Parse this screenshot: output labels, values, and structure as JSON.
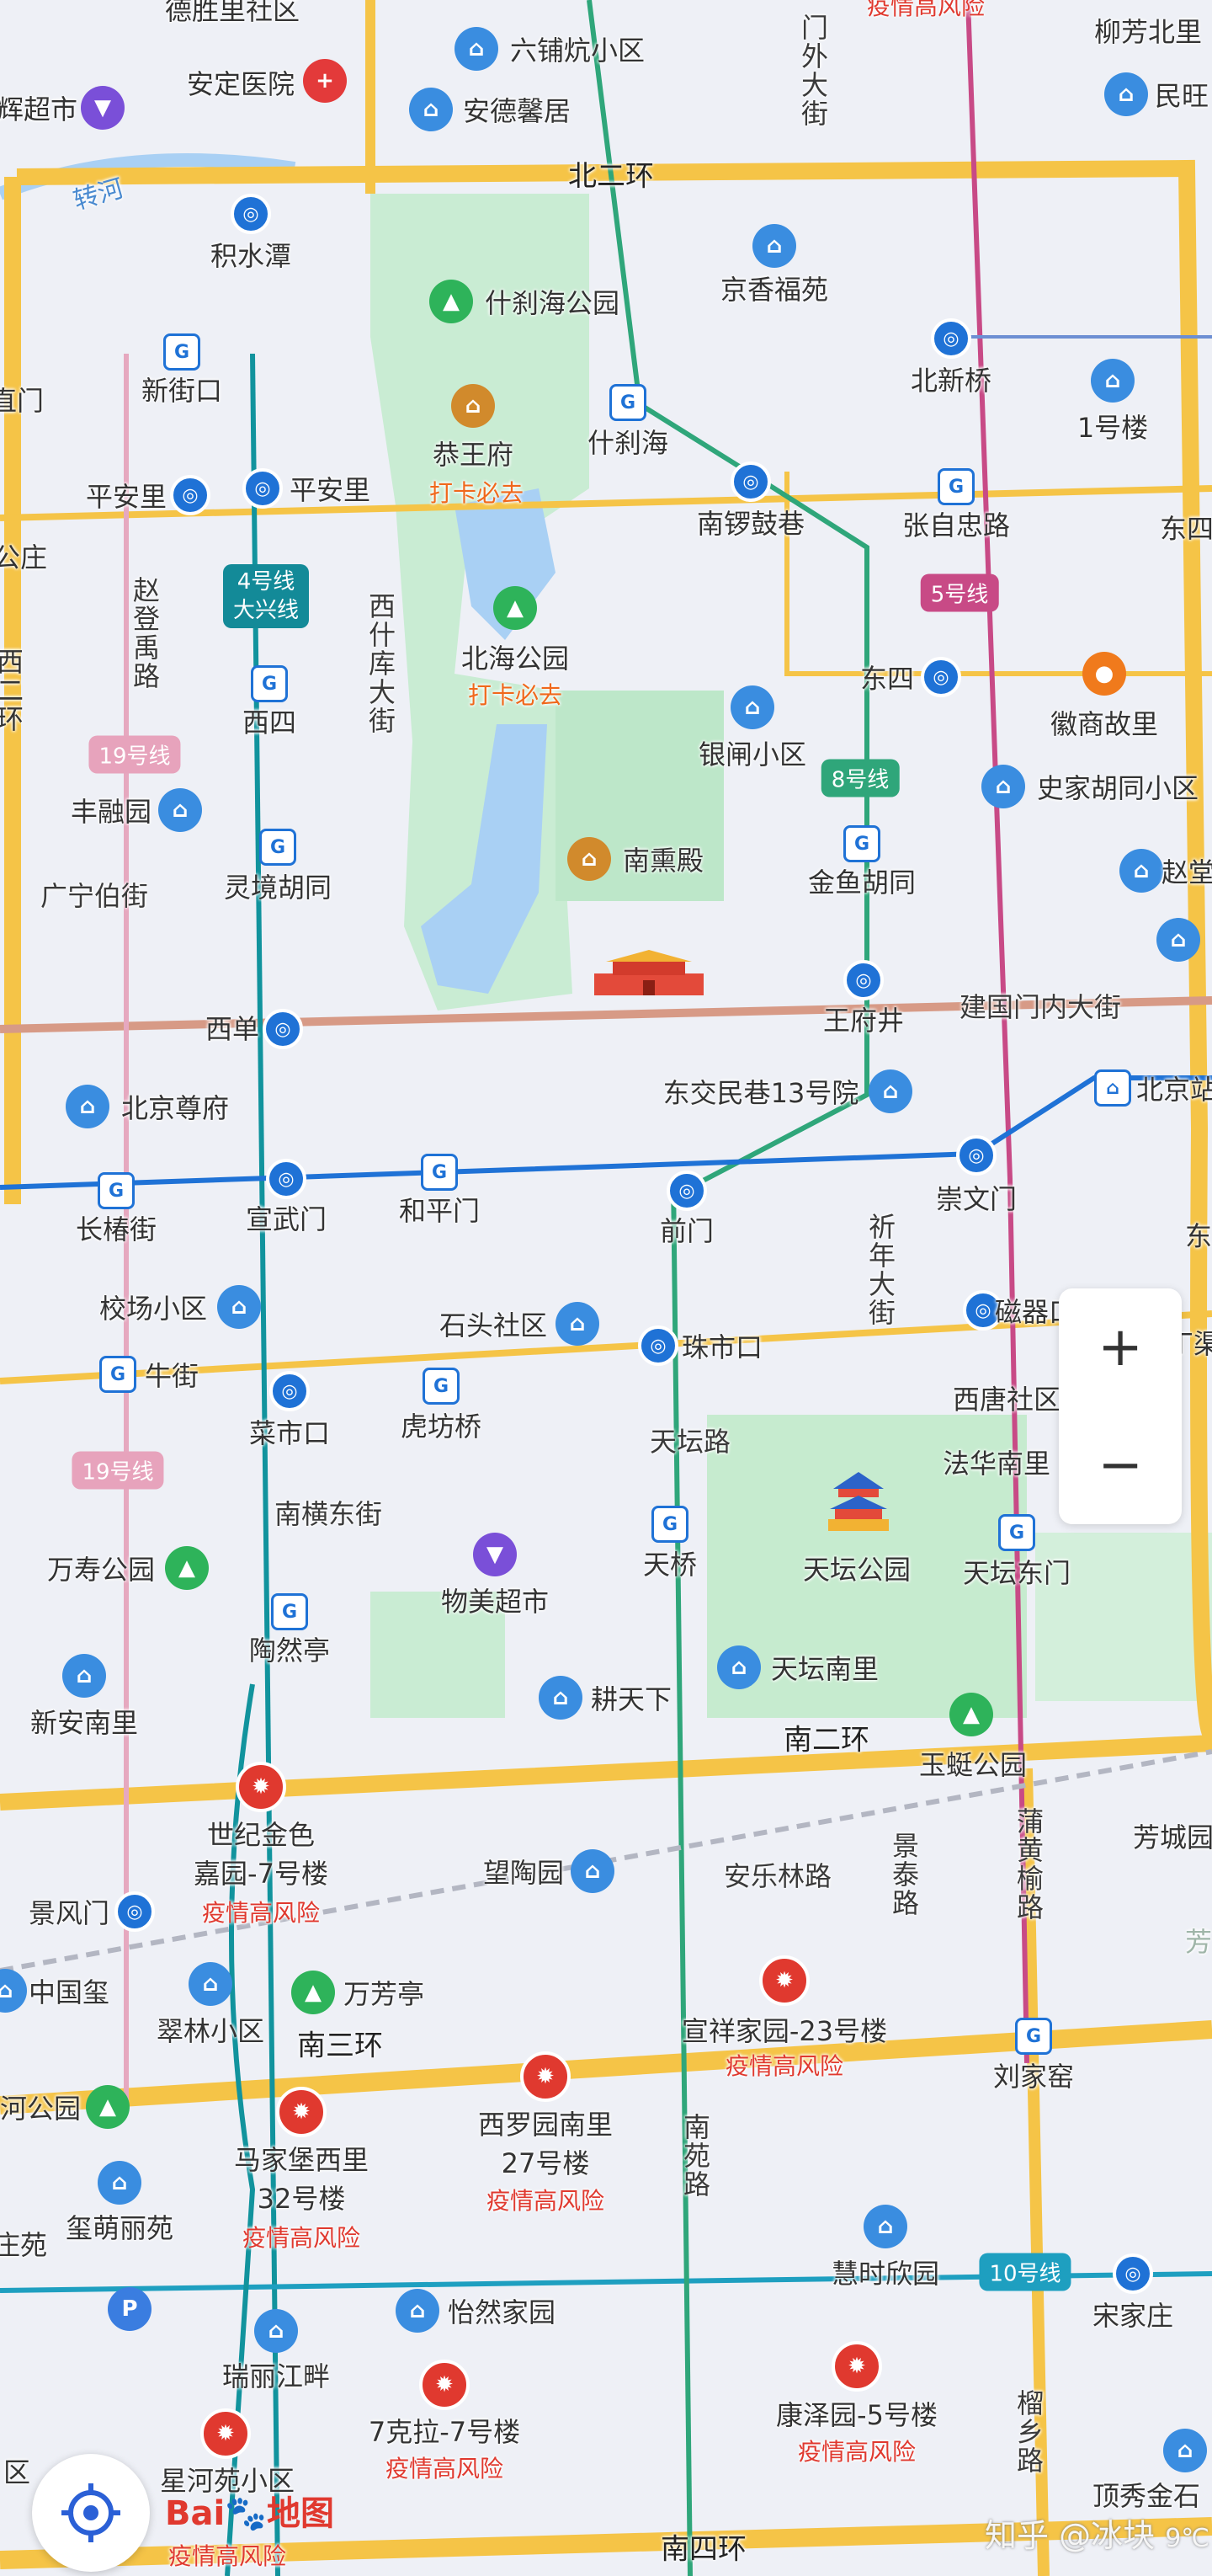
{
  "map": {
    "roads": {
      "ring2_north": "北二环",
      "ring2_south": "南二环",
      "ring3_south": "南三环",
      "ring4_south": "南四环",
      "jianguomen": "建国门内大街",
      "xishiku": "西什库大街",
      "zhaodengyu": "赵登禹路",
      "qinian": "祈年大街",
      "jingtai": "景泰路",
      "puhuangyu": "蒲黄榆路",
      "nanyuan": "南苑路",
      "liuxiang": "榴乡路",
      "tiantan_road": "天坛路",
      "nanheng_east": "南横东街",
      "guangning": "广宁伯街",
      "anle": "安乐林路",
      "outer_gate": "门外大街",
      "river": "转河"
    },
    "lines": {
      "line4": "4号线\n大兴线",
      "line5": "5号线",
      "line8": "8号线",
      "line10": "10号线",
      "line19a": "19号线",
      "line19b": "19号线"
    },
    "stations": {
      "jishuitan": "积水潭",
      "xinjiekou": "新街口",
      "pinganli": "平安里",
      "pinganli2": "平安里",
      "xisi": "西四",
      "lingjing": "灵境胡同",
      "xidan": "西单",
      "xuanwumen": "宣武门",
      "changchunjie": "长椿街",
      "hepingmen": "和平门",
      "qianmen": "前门",
      "chongwenmen": "崇文门",
      "shichahai": "什刹海",
      "nanluoguxiang": "南锣鼓巷",
      "zhangzizhong": "张自忠路",
      "beixinqiao": "北新桥",
      "dongsi": "东四",
      "jinyuhutong": "金鱼胡同",
      "wangfujing": "王府井",
      "zhushikou": "珠市口",
      "tianqiao": "天桥",
      "ciqikou": "磁器口",
      "tiantan_east": "天坛东门",
      "caishikou": "菜市口",
      "hufangqiao": "虎坊桥",
      "taoranting": "陶然亭",
      "niujie": "牛街",
      "jingfengmen": "景风门",
      "liujiayao": "刘家窑",
      "songjiazhuang": "宋家庄",
      "beijing_station": "北京站",
      "xizhimen": "直门",
      "xizhi2": "西二环"
    },
    "pois": {
      "desheng": "德胜里社区",
      "liupukang": "六铺炕小区",
      "liufang_north": "柳芳北里",
      "anding_hosp": "安定医院",
      "andingxin": "安德馨居",
      "minwang": "民旺",
      "hui_market": "辉超市",
      "shichahai_park": "什刹海公园",
      "jingxiang": "京香福苑",
      "gongwangfu": "恭王府",
      "checkin1": "打卡必去",
      "yihao": "1号楼",
      "beihai": "北海公园",
      "checkin2": "打卡必去",
      "yinzha": "银闸小区",
      "huishang": "徽商故里",
      "shijia": "史家胡同小区",
      "fengrong": "丰融园",
      "nanxun": "南熏殿",
      "zhaotang": "赵堂",
      "bj_zunfu": "北京尊府",
      "dongjiao": "东交民巷13号院",
      "xiaochang": "校场小区",
      "shitou": "石头社区",
      "xitang": "西唐社区",
      "fahua": "法华南里",
      "wanshou": "万寿公园",
      "wumei": "物美超市",
      "tiantan_park": "天坛公园",
      "xinan": "新安南里",
      "gengtianxia": "耕天下",
      "tiantan_south": "天坛南里",
      "yuting": "玉蜓公园",
      "shiji": "世纪金色\n嘉园-7号楼",
      "risk1": "疫情高风险",
      "wangtao": "望陶园",
      "fangcheng": "芳城园",
      "zhongguoxi": "中国玺",
      "cuilin": "翠林小区",
      "wanfangting": "万芳亭",
      "xuanxiang": "宣祥家园-23号楼",
      "risk2": "疫情高风险",
      "xiluo": "西罗园南里\n27号楼",
      "risk3": "疫情高风险",
      "majiabao": "马家堡西里\n32号楼",
      "risk4": "疫情高风险",
      "helu_park": "河公园",
      "ximeng": "玺萌丽苑",
      "huishixin": "慧时欣园",
      "yiran": "怡然家园",
      "ruili": "瑞丽江畔",
      "qikela": "7克拉-7号楼",
      "risk5": "疫情高风险",
      "kangze": "康泽园-5号楼",
      "risk6": "疫情高风险",
      "xinghe": "星河苑小区",
      "risk7": "疫情高风险",
      "dingxiu": "顶秀金石",
      "risk_top": "疫情高风险",
      "dong_kou": "东",
      "dong4": "东四",
      "dongcheng": "东",
      "fang": "芳",
      "qu": "区",
      "zhuang": "庄苑",
      "jizhai": "公庄",
      "qiaoka": "丁渠"
    },
    "controls": {
      "zoom_in": "+",
      "zoom_out": "−",
      "logo_bai": "Bai",
      "logo_du": "du",
      "logo_map": "地图",
      "watermark": "知乎 @冰块",
      "temp": "9℃"
    },
    "colors": {
      "ring_road": "#f5c447",
      "line4": "#138a98",
      "line5": "#c84a86",
      "line8": "#2fa67a",
      "line10": "#1e9fc0",
      "park": "#bde7c9",
      "water": "#a6cdf2",
      "risk": "#e0392f"
    }
  }
}
